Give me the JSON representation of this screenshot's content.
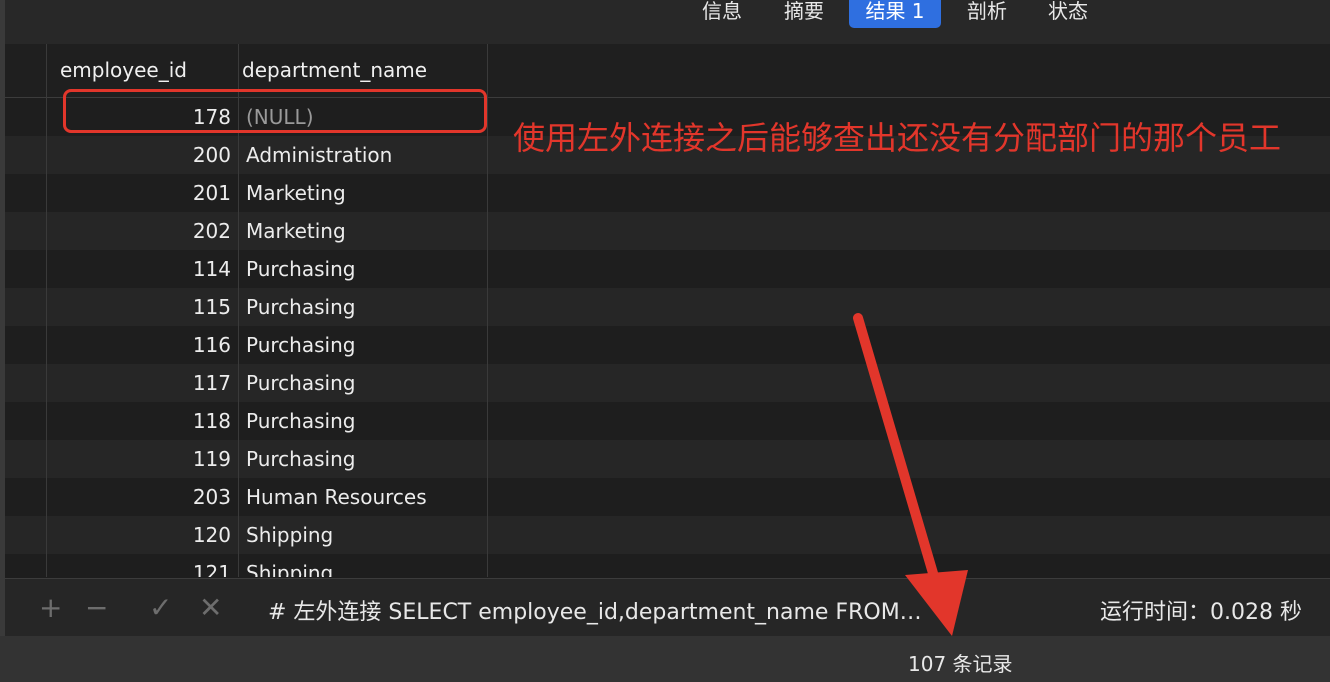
{
  "tabs": [
    {
      "label": "信息"
    },
    {
      "label": "摘要"
    },
    {
      "label": "结果 1"
    },
    {
      "label": "剖析"
    },
    {
      "label": "状态"
    }
  ],
  "columns": {
    "employee_id": "employee_id",
    "department_name": "department_name"
  },
  "rows": [
    {
      "id": "178",
      "dept": "(NULL)"
    },
    {
      "id": "200",
      "dept": "Administration"
    },
    {
      "id": "201",
      "dept": "Marketing"
    },
    {
      "id": "202",
      "dept": "Marketing"
    },
    {
      "id": "114",
      "dept": "Purchasing"
    },
    {
      "id": "115",
      "dept": "Purchasing"
    },
    {
      "id": "116",
      "dept": "Purchasing"
    },
    {
      "id": "117",
      "dept": "Purchasing"
    },
    {
      "id": "118",
      "dept": "Purchasing"
    },
    {
      "id": "119",
      "dept": "Purchasing"
    },
    {
      "id": "203",
      "dept": "Human Resources"
    },
    {
      "id": "120",
      "dept": "Shipping"
    },
    {
      "id": "121",
      "dept": "Shipping"
    }
  ],
  "annotation": "使用左外连接之后能够查出还没有分配部门的那个员工",
  "toolbar": {
    "query": "# 左外连接 SELECT employee_id,department_name FROM…",
    "runtime": "运行时间：0.028 秒"
  },
  "status": {
    "records": "107 条记录"
  },
  "colors": {
    "accent": "#2f6fe0",
    "annotation": "#e2362b"
  }
}
